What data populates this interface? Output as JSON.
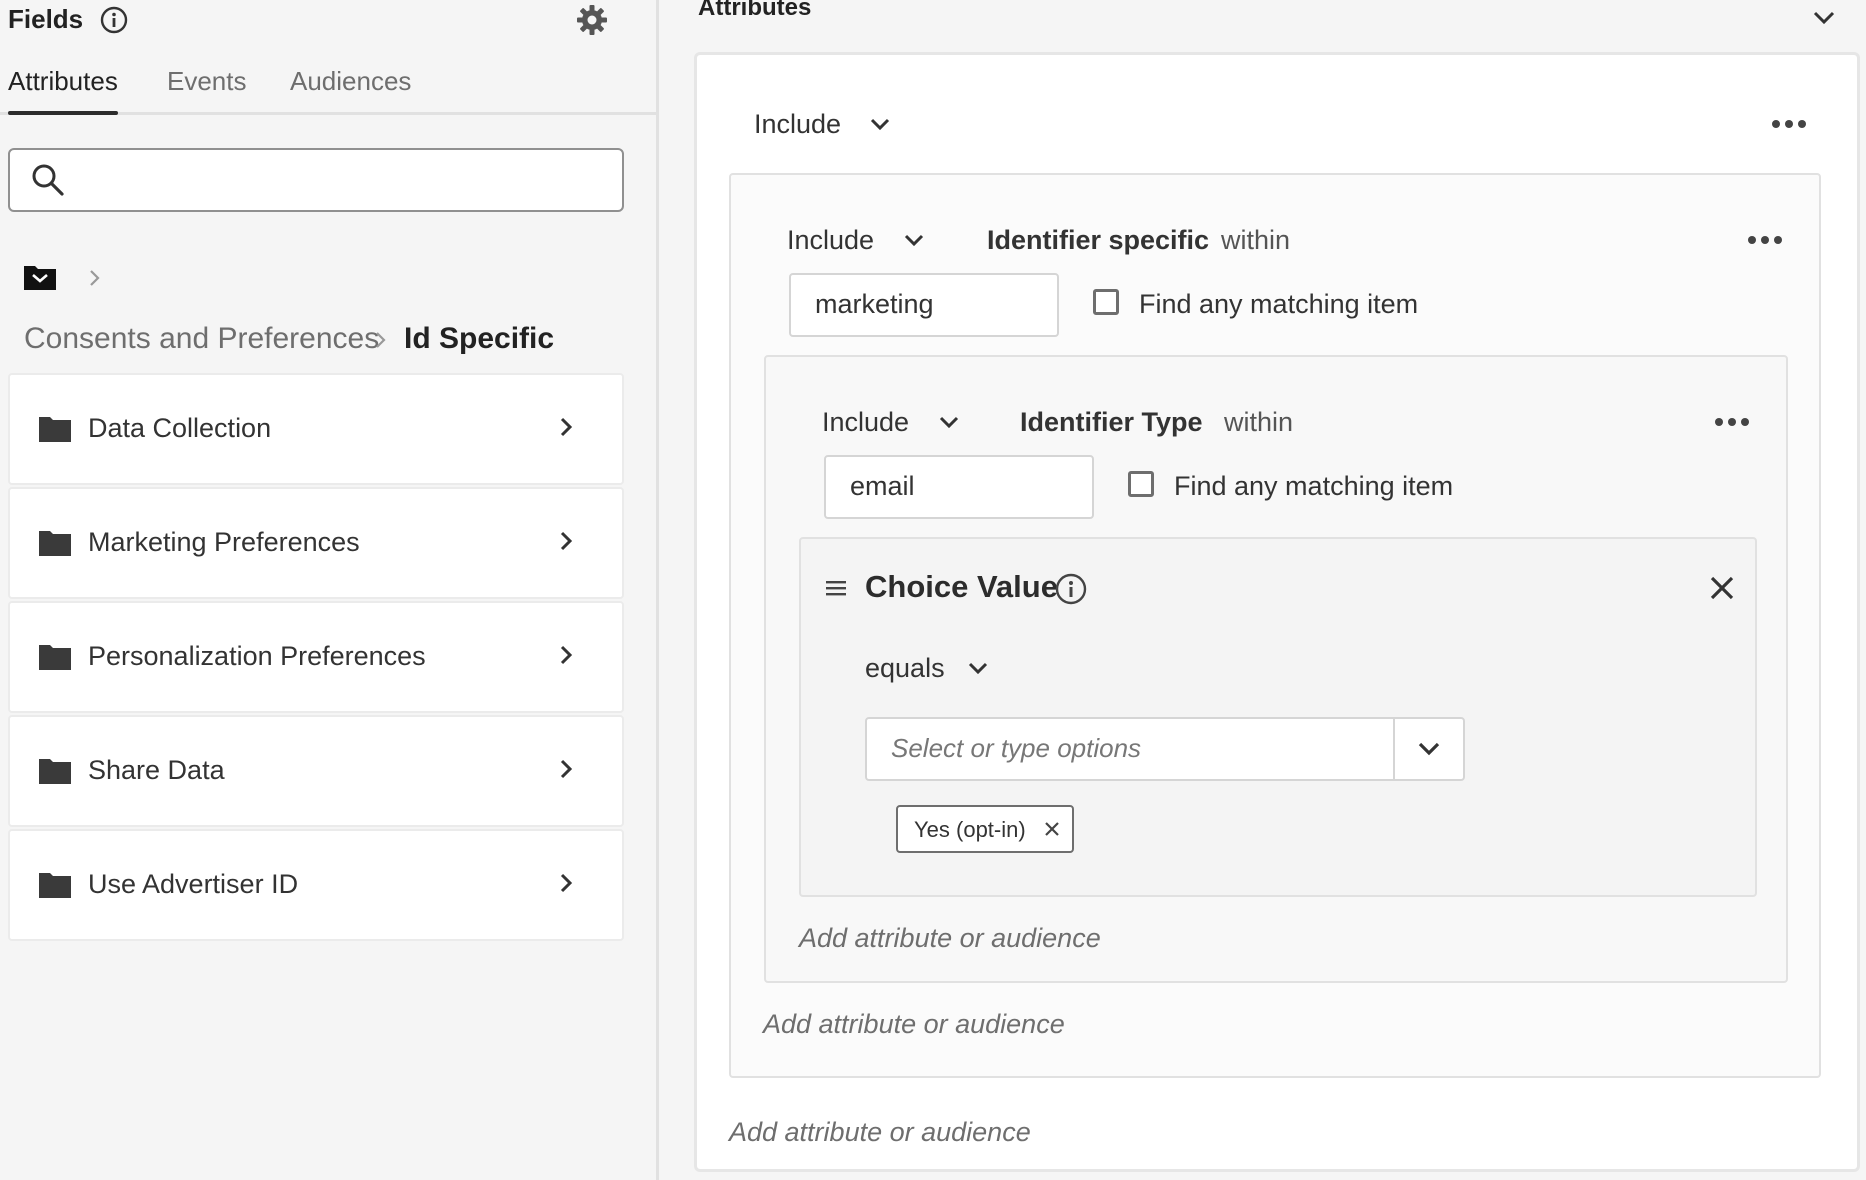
{
  "left_panel": {
    "title": "Fields",
    "tabs": [
      {
        "label": "Attributes",
        "active": true
      },
      {
        "label": "Events",
        "active": false
      },
      {
        "label": "Audiences",
        "active": false
      }
    ],
    "search": {
      "value": "",
      "placeholder": ""
    },
    "breadcrumb": {
      "parent": "Consents and Preferences",
      "current": "Id Specific"
    },
    "folders": [
      {
        "label": "Data Collection"
      },
      {
        "label": "Marketing Preferences"
      },
      {
        "label": "Personalization Preferences"
      },
      {
        "label": "Share Data"
      },
      {
        "label": "Use Advertiser ID"
      }
    ]
  },
  "right_panel": {
    "heading": "Attributes",
    "outer_container": {
      "operator": "Include",
      "add_label": "Add attribute or audience"
    },
    "container_1": {
      "operator": "Include",
      "field_label": "Identifier specific",
      "within_label": "within",
      "value": "marketing",
      "checkbox_label": "Find any matching item",
      "checkbox_checked": false,
      "add_label": "Add attribute or audience"
    },
    "container_2": {
      "operator": "Include",
      "field_label": "Identifier Type",
      "within_label": "within",
      "value": "email",
      "checkbox_label": "Find any matching item",
      "checkbox_checked": false,
      "add_label": "Add attribute or audience"
    },
    "condition": {
      "title": "Choice Value",
      "operator": "equals",
      "options_placeholder": "Select or type options",
      "selected_tags": [
        "Yes (opt-in)"
      ]
    }
  },
  "colors": {
    "background": "#f5f5f5",
    "card": "#ffffff",
    "border": "#e1e1e1",
    "text": "#2c2c2c",
    "muted": "#6e6e6e"
  },
  "icons": [
    "info-icon",
    "gear-icon",
    "search-icon",
    "folder-icon",
    "chevron-right-icon",
    "chevron-down-icon",
    "more-icon",
    "drag-handle-icon",
    "close-icon"
  ]
}
